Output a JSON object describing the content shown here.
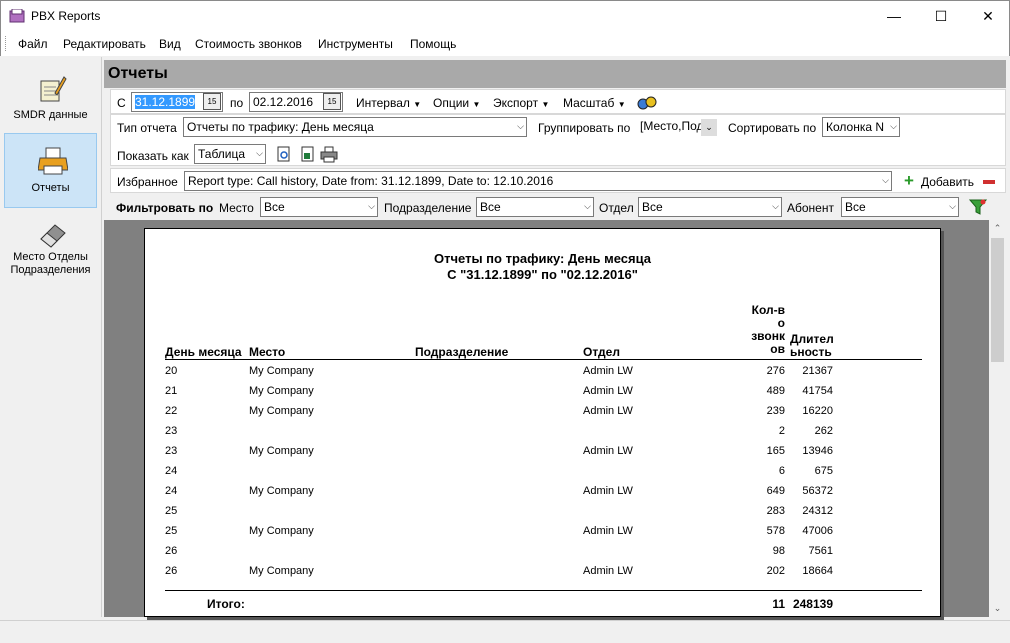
{
  "window": {
    "title": "PBX Reports"
  },
  "menu": [
    "Файл",
    "Редактировать",
    "Вид",
    "Стоимость звонков",
    "Инструменты",
    "Помощь"
  ],
  "sidebar": {
    "items": [
      {
        "label": "SMDR данные",
        "icon": "notepad-pencil-icon",
        "active": false
      },
      {
        "label": "Отчеты",
        "icon": "printer-icon",
        "active": true
      },
      {
        "label": "Место Отделы Подразделения",
        "icon": "eraser-icon",
        "active": false
      }
    ]
  },
  "header": {
    "title": "Отчеты"
  },
  "toolbar": {
    "from_label": "С",
    "date_from": "31.12.1899",
    "to_label": "по",
    "date_to": "02.12.2016",
    "interval": "Интервал",
    "options": "Опции",
    "export": "Экспорт",
    "scale": "Масштаб"
  },
  "report_type": {
    "label": "Тип отчета",
    "value": "Отчеты по трафику: День месяца",
    "group_label": "Группировать по",
    "group_value": "[Место,Под",
    "sort_label": "Сортировать по",
    "sort_value": "Колонка N"
  },
  "show_as": {
    "label": "Показать как",
    "value": "Таблица"
  },
  "favorites": {
    "label": "Избранное",
    "value": "Report type: Call history, Date from: 31.12.1899, Date to: 12.10.2016",
    "add_label": "Добавить"
  },
  "filter": {
    "label": "Фильтровать по",
    "place_label": "Место",
    "place_value": "Все",
    "division_label": "Подразделение",
    "division_value": "Все",
    "dept_label": "Отдел",
    "dept_value": "Все",
    "subscriber_label": "Абонент",
    "subscriber_value": "Все"
  },
  "report": {
    "title_line1": "Отчеты по трафику: День месяца",
    "title_line2": "С \"31.12.1899\" по \"02.12.2016\"",
    "headers": {
      "day": "День месяца",
      "place": "Место",
      "division": "Подразделение",
      "dept": "Отдел",
      "calls": [
        "Кол-в",
        "о",
        "звонк",
        "ов"
      ],
      "duration": [
        "Длител",
        "ьность"
      ]
    },
    "rows": [
      {
        "day": "20",
        "place": "My Company",
        "dept": "Admin LW",
        "calls": "276",
        "duration": "21367"
      },
      {
        "day": "21",
        "place": "My Company",
        "dept": "Admin LW",
        "calls": "489",
        "duration": "41754"
      },
      {
        "day": "22",
        "place": "My Company",
        "dept": "Admin LW",
        "calls": "239",
        "duration": "16220"
      },
      {
        "day": "23",
        "place": "",
        "dept": "",
        "calls": "2",
        "duration": "262"
      },
      {
        "day": "23",
        "place": "My Company",
        "dept": "Admin LW",
        "calls": "165",
        "duration": "13946"
      },
      {
        "day": "24",
        "place": "",
        "dept": "",
        "calls": "6",
        "duration": "675"
      },
      {
        "day": "24",
        "place": "My Company",
        "dept": "Admin LW",
        "calls": "649",
        "duration": "56372"
      },
      {
        "day": "25",
        "place": "",
        "dept": "",
        "calls": "283",
        "duration": "24312"
      },
      {
        "day": "25",
        "place": "My Company",
        "dept": "Admin LW",
        "calls": "578",
        "duration": "47006"
      },
      {
        "day": "26",
        "place": "",
        "dept": "",
        "calls": "98",
        "duration": "7561"
      },
      {
        "day": "26",
        "place": "My Company",
        "dept": "Admin LW",
        "calls": "202",
        "duration": "18664"
      }
    ],
    "total": {
      "label": "Итого:",
      "calls": "11",
      "duration": "248139"
    }
  }
}
